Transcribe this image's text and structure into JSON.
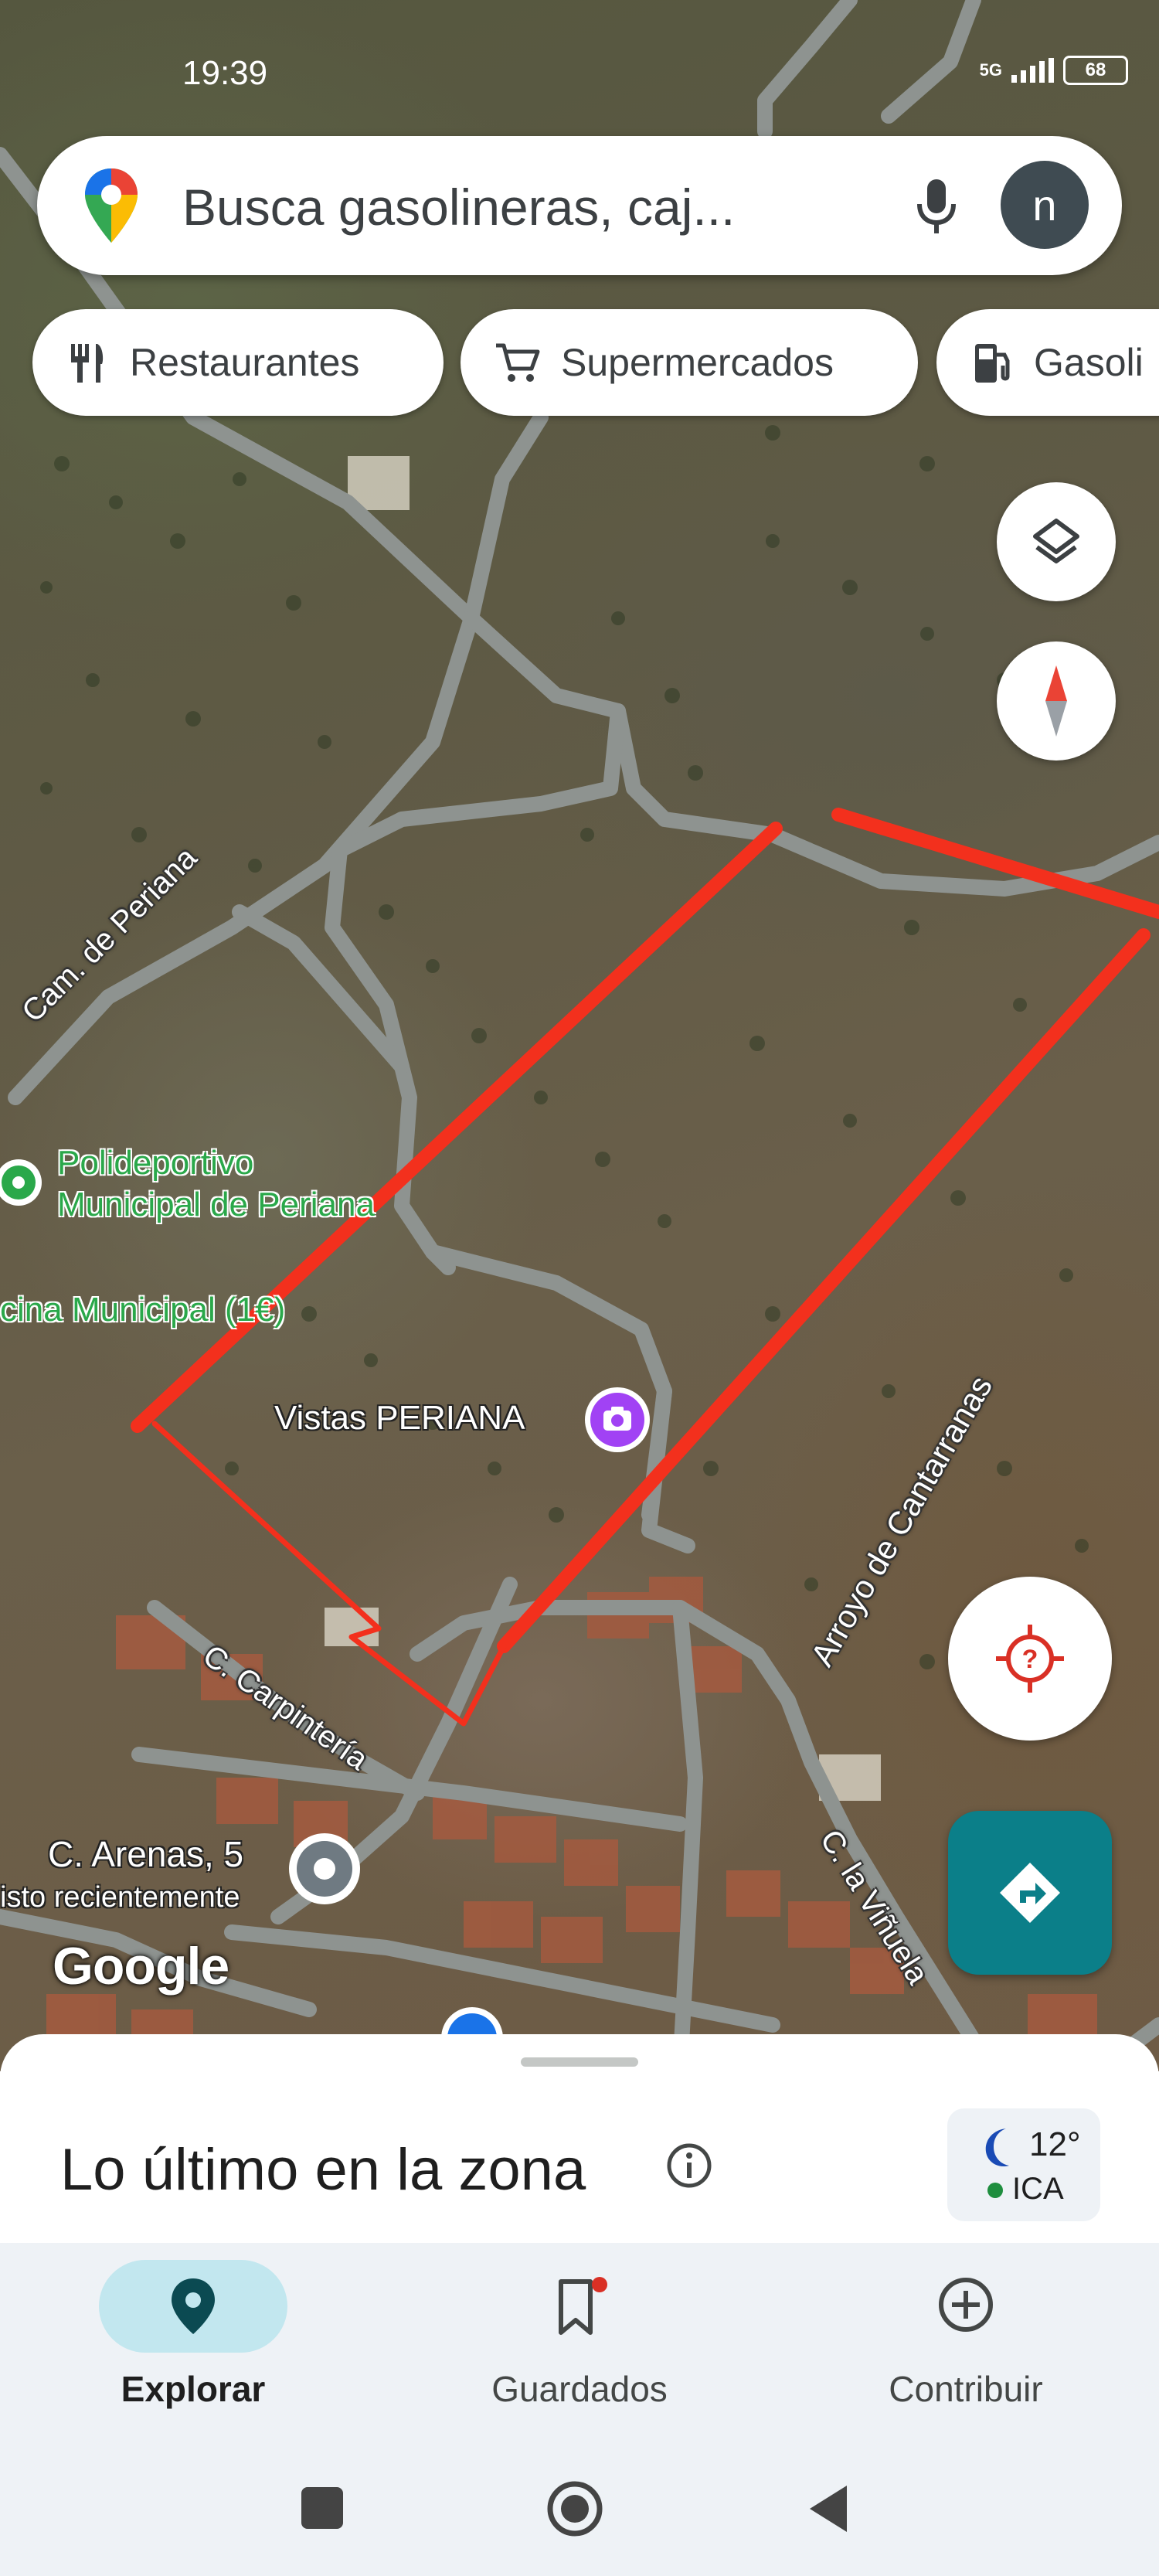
{
  "status_bar": {
    "time": "19:39",
    "network": "5G",
    "battery": "68"
  },
  "search": {
    "placeholder": "Busca gasolineras, caj...",
    "avatar_letter": "n"
  },
  "chips": [
    {
      "label": "Restaurantes",
      "icon": "fork-knife-icon"
    },
    {
      "label": "Supermercados",
      "icon": "cart-icon"
    },
    {
      "label": "Gasoli",
      "icon": "gas-station-icon"
    }
  ],
  "map": {
    "labels": {
      "road_periana": "Cam. de Periana",
      "poi_polideportivo_line1": "Polideportivo",
      "poi_polideportivo_line2": "Municipal de Periana",
      "poi_piscina": "cina Municipal (1€)",
      "poi_vistas": "Vistas PERIANA",
      "road_arroyo": "Arroyo de Cantarranas",
      "road_carpinteria": "C. Carpintería",
      "address_title": "C. Arenas, 5",
      "address_subtitle": "isto recientemente",
      "road_vinuela": "C. la Viñuela",
      "google_logo": "Google"
    },
    "colors": {
      "boundary": "#f3301d",
      "roads": "#8e9390",
      "poi_green": "#2aa84a",
      "poi_purple": "#a142f4"
    }
  },
  "sheet": {
    "title": "Lo último en la zona",
    "weather": {
      "temp": "12°",
      "aqi": "ICA"
    }
  },
  "nav": {
    "items": [
      {
        "label": "Explorar",
        "icon": "explore-pin-icon",
        "active": true
      },
      {
        "label": "Guardados",
        "icon": "bookmark-icon",
        "active": false
      },
      {
        "label": "Contribuir",
        "icon": "add-circle-icon",
        "active": false
      }
    ]
  },
  "colors": {
    "accent": "#0b7f89",
    "nav_bg": "#eef2f6",
    "nav_active_pill": "#c2e7ef"
  }
}
